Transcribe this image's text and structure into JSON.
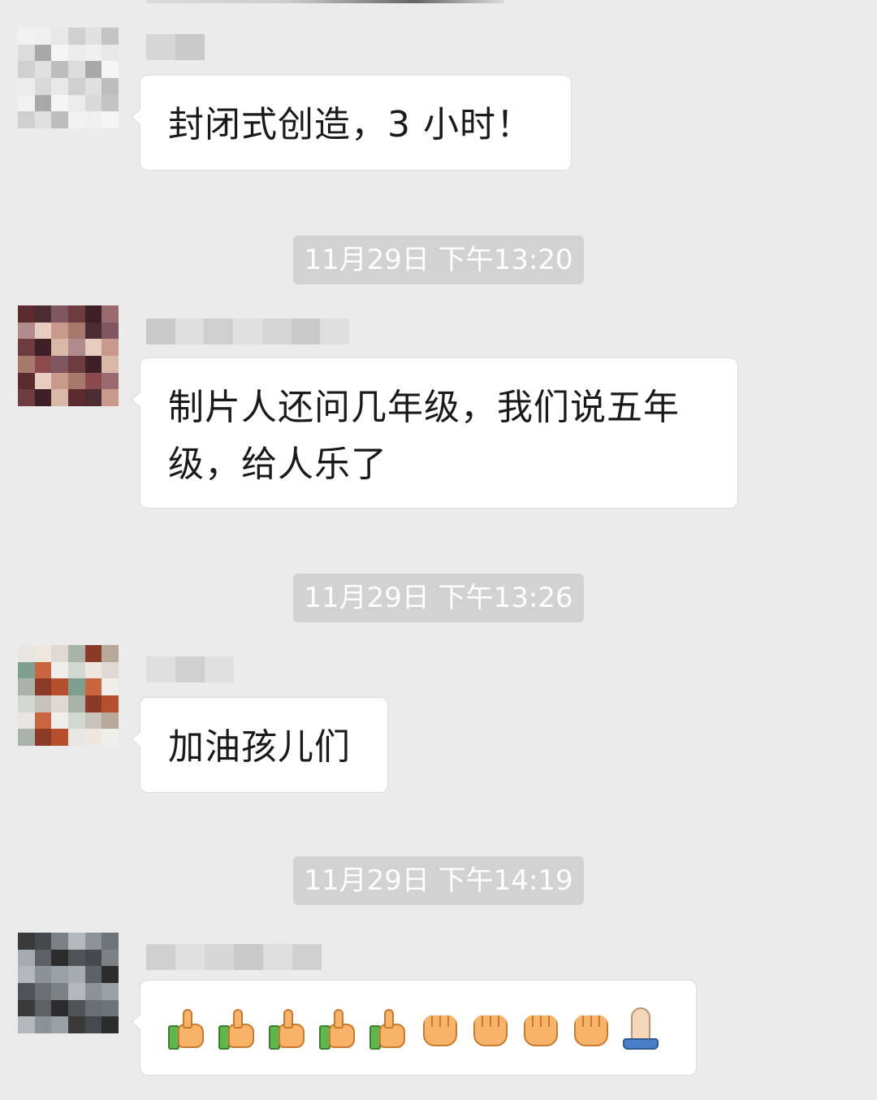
{
  "messages": [
    {
      "text": "封闭式创造，3 小时！",
      "avatar_icon": "blurred-avatar-icon",
      "sender_label": "blurred-sender-name"
    },
    {
      "timestamp": "11月29日 下午13:20",
      "text_lines": [
        "制片人还问几年级，我们说五年",
        "级，给人乐了"
      ],
      "avatar_icon": "blurred-avatar-icon",
      "sender_label": "blurred-sender-name"
    },
    {
      "timestamp": "11月29日 下午13:26",
      "text": "加油孩儿们",
      "avatar_icon": "blurred-avatar-icon",
      "sender_label": "blurred-sender-name"
    },
    {
      "timestamp": "11月29日 下午14:19",
      "emojis": [
        "thumbs-up-icon",
        "thumbs-up-icon",
        "thumbs-up-icon",
        "thumbs-up-icon",
        "thumbs-up-icon",
        "fist-icon",
        "fist-icon",
        "fist-icon",
        "fist-icon",
        "folded-hands-icon"
      ],
      "avatar_icon": "blurred-avatar-icon",
      "sender_label": "blurred-sender-name"
    }
  ],
  "colors": {
    "background": "#ebebeb",
    "bubble": "#ffffff",
    "timestamp_bg": "#d2d2d2",
    "timestamp_text": "#ffffff",
    "text": "#1a1a1a"
  }
}
